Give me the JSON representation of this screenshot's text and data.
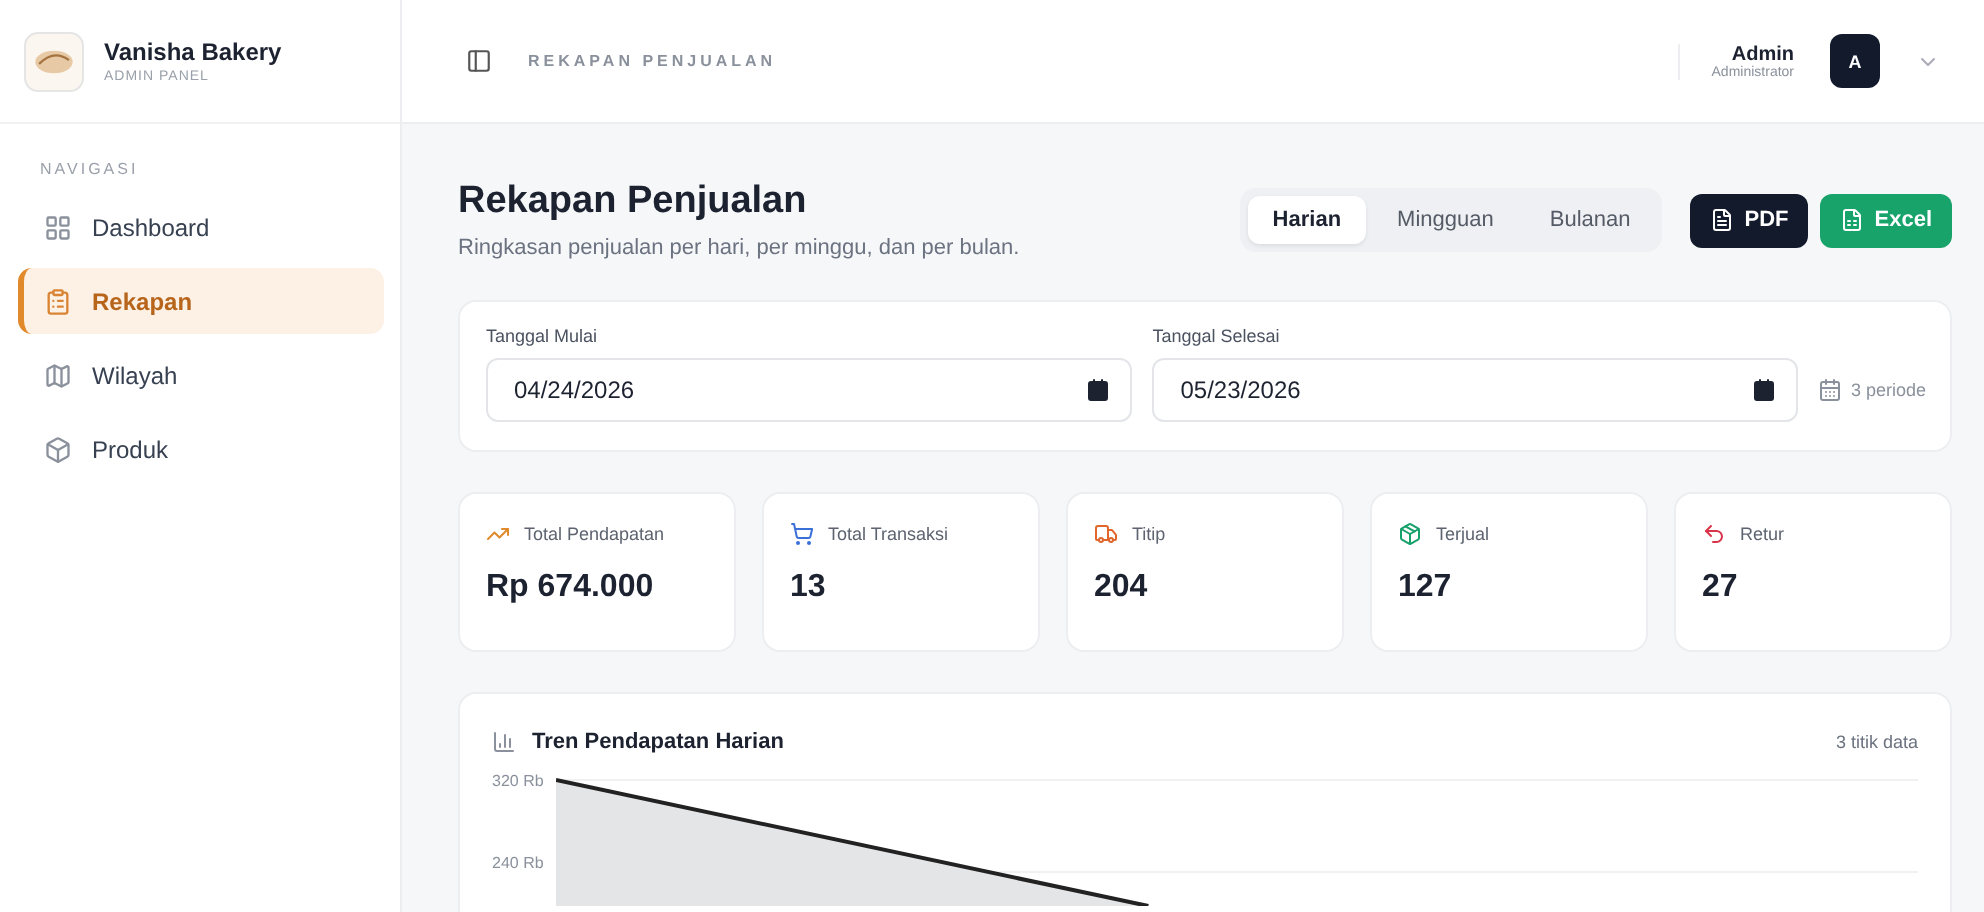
{
  "brand": {
    "name": "Vanisha Bakery",
    "subtitle": "ADMIN PANEL"
  },
  "sidebar": {
    "heading": "NAVIGASI",
    "items": [
      {
        "label": "Dashboard",
        "selected": false
      },
      {
        "label": "Rekapan",
        "selected": true
      },
      {
        "label": "Wilayah",
        "selected": false
      },
      {
        "label": "Produk",
        "selected": false
      }
    ]
  },
  "header": {
    "breadcrumb": "REKAPAN PENJUALAN",
    "user": {
      "name": "Admin",
      "role": "Administrator",
      "initial": "A"
    }
  },
  "page": {
    "title": "Rekapan Penjualan",
    "subtitle": "Ringkasan penjualan per hari, per minggu, dan per bulan.",
    "periods": [
      {
        "label": "Harian",
        "selected": true
      },
      {
        "label": "Mingguan",
        "selected": false
      },
      {
        "label": "Bulanan",
        "selected": false
      }
    ],
    "exports": [
      {
        "label": "PDF",
        "kind": "pdf"
      },
      {
        "label": "Excel",
        "kind": "excel"
      }
    ]
  },
  "filters": {
    "start": {
      "label": "Tanggal Mulai",
      "value": "04/24/2026"
    },
    "end": {
      "label": "Tanggal Selesai",
      "value": "05/23/2026"
    },
    "period_count": "3 periode"
  },
  "stats": [
    {
      "label": "Total Pendapatan",
      "value": "Rp 674.000",
      "color": "#e08a2c"
    },
    {
      "label": "Total Transaksi",
      "value": "13",
      "color": "#3b6fd8"
    },
    {
      "label": "Titip",
      "value": "204",
      "color": "#e0662c"
    },
    {
      "label": "Terjual",
      "value": "127",
      "color": "#16a06a"
    },
    {
      "label": "Retur",
      "value": "27",
      "color": "#d9344a"
    }
  ],
  "chart": {
    "title": "Tren Pendapatan Harian",
    "count": "3 titik data",
    "ytick_labels": [
      "320 Rb",
      "240 Rb"
    ]
  }
}
